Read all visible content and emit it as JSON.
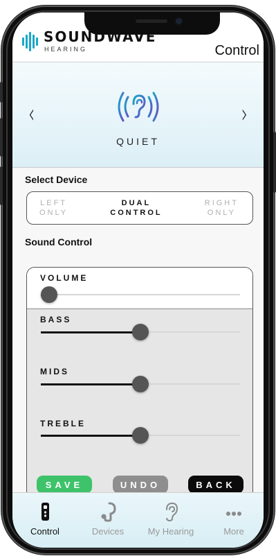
{
  "brand": {
    "name": "SOUNDWAVE",
    "subtitle": "HEARING"
  },
  "header": {
    "title": "Control"
  },
  "mode": {
    "name": "QUIET",
    "prev_arrow": "‹",
    "next_arrow": "›"
  },
  "device": {
    "section_label": "Select Device",
    "options": [
      {
        "line1": "LEFT",
        "line2": "ONLY",
        "selected": false
      },
      {
        "line1": "DUAL",
        "line2": "CONTROL",
        "selected": true
      },
      {
        "line1": "RIGHT",
        "line2": "ONLY",
        "selected": false
      }
    ]
  },
  "sound": {
    "section_label": "Sound Control",
    "sliders": [
      {
        "label": "VOLUME",
        "value": 0.04
      },
      {
        "label": "BASS",
        "value": 0.5
      },
      {
        "label": "MIDS",
        "value": 0.5
      },
      {
        "label": "TREBLE",
        "value": 0.5
      }
    ],
    "buttons": {
      "save": "SAVE",
      "undo": "UNDO",
      "back": "BACK"
    }
  },
  "tabs": [
    {
      "label": "Control",
      "icon": "remote-control-icon",
      "active": true
    },
    {
      "label": "Devices",
      "icon": "hearing-aid-icon",
      "active": false
    },
    {
      "label": "My Hearing",
      "icon": "ear-icon",
      "active": false
    },
    {
      "label": "More",
      "icon": "more-dots-icon",
      "active": false
    }
  ],
  "colors": {
    "accent_blue": "#1aa7c9",
    "mode_icon_purple": "#6a4bc4",
    "save": "#3ec26a",
    "undo": "#8e8e8e",
    "back": "#0b0b0b"
  }
}
